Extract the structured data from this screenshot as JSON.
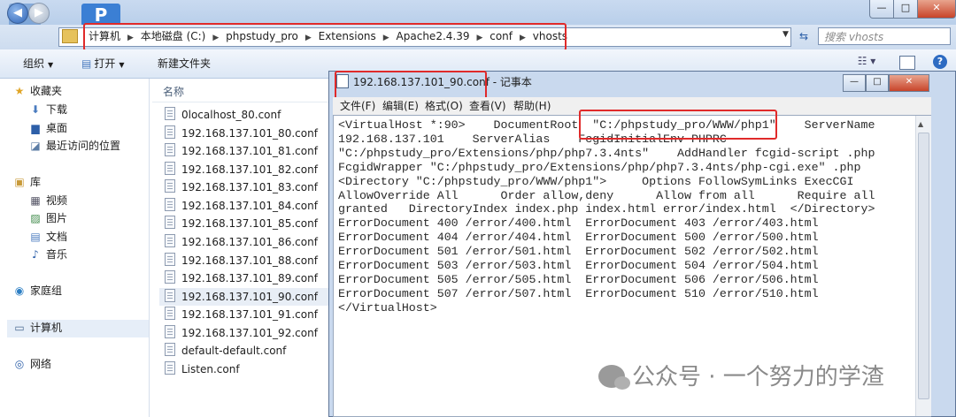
{
  "explorer": {
    "window_controls": {
      "minimize": "—",
      "maximize": "□",
      "close": "✕"
    },
    "nav": {
      "back_glyph": "◀",
      "forward_glyph": "▶"
    },
    "breadcrumb": [
      "计算机",
      "本地磁盘 (C:)",
      "phpstudy_pro",
      "Extensions",
      "Apache2.4.39",
      "conf",
      "vhosts"
    ],
    "search_placeholder": "搜索 vhosts",
    "toolbar": {
      "organize": "组织",
      "open": "打开",
      "new_folder": "新建文件夹"
    },
    "nav_pane": {
      "favorites": "收藏夹",
      "favorites_items": [
        "下载",
        "桌面",
        "最近访问的位置"
      ],
      "libraries": "库",
      "library_items": [
        "视频",
        "图片",
        "文档",
        "音乐"
      ],
      "homegroup": "家庭组",
      "computer": "计算机",
      "network": "网络"
    },
    "column_name": "名称",
    "files": [
      "0localhost_80.conf",
      "192.168.137.101_80.conf",
      "192.168.137.101_81.conf",
      "192.168.137.101_82.conf",
      "192.168.137.101_83.conf",
      "192.168.137.101_84.conf",
      "192.168.137.101_85.conf",
      "192.168.137.101_86.conf",
      "192.168.137.101_88.conf",
      "192.168.137.101_89.conf",
      "192.168.137.101_90.conf",
      "192.168.137.101_91.conf",
      "192.168.137.101_92.conf",
      "default-default.conf",
      "Listen.conf"
    ],
    "selected_file": "192.168.137.101_90.conf"
  },
  "notepad": {
    "title": "192.168.137.101_90.conf - 记事本",
    "window_controls": {
      "minimize": "—",
      "maximize": "□",
      "close": "✕"
    },
    "menu": [
      "文件(F)",
      "编辑(E)",
      "格式(O)",
      "查看(V)",
      "帮助(H)"
    ],
    "content": "<VirtualHost *:90>    DocumentRoot  \"C:/phpstudy_pro/WWW/php1\"    ServerName\n192.168.137.101    ServerAlias    FcgidInitialEnv PHPRC\n\"C:/phpstudy_pro/Extensions/php/php7.3.4nts\"    AddHandler fcgid-script .php\nFcgidWrapper \"C:/phpstudy_pro/Extensions/php/php7.3.4nts/php-cgi.exe\" .php\n<Directory \"C:/phpstudy_pro/WWW/php1\">     Options FollowSymLinks ExecCGI\nAllowOverride All      Order allow,deny      Allow from all      Require all\ngranted   DirectoryIndex index.php index.html error/index.html  </Directory>\nErrorDocument 400 /error/400.html  ErrorDocument 403 /error/403.html\nErrorDocument 404 /error/404.html  ErrorDocument 500 /error/500.html\nErrorDocument 501 /error/501.html  ErrorDocument 502 /error/502.html\nErrorDocument 503 /error/503.html  ErrorDocument 504 /error/504.html\nErrorDocument 505 /error/505.html  ErrorDocument 506 /error/506.html\nErrorDocument 507 /error/507.html  ErrorDocument 510 /error/510.html\n</VirtualHost>"
  },
  "watermark": "公众号 · 一个努力的学渣",
  "colors": {
    "highlight_box": "#e02a2a",
    "selection": "#e8eef6",
    "window_frame": "#c9d9ee"
  }
}
